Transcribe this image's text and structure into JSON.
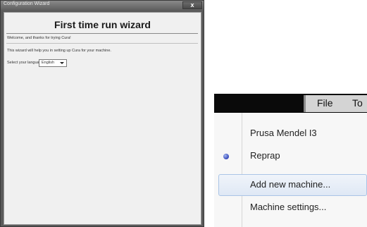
{
  "wizard": {
    "window_title": "Configuration Wizard",
    "close_label": "x",
    "heading": "First time run wizard",
    "welcome_text": "Welcome, and thanks for trying Cura!",
    "info_text": "This wizard will help you in setting up Cura for your machine.",
    "language_label": "Select your language:",
    "language_value": "English"
  },
  "menu": {
    "bar_items": [
      "File",
      "To"
    ],
    "items": [
      {
        "label": "Prusa Mendel I3",
        "selected": false
      },
      {
        "label": "Reprap",
        "selected": true
      },
      {
        "label": "Add new machine...",
        "hovered": true
      },
      {
        "label": "Machine settings..."
      }
    ]
  }
}
